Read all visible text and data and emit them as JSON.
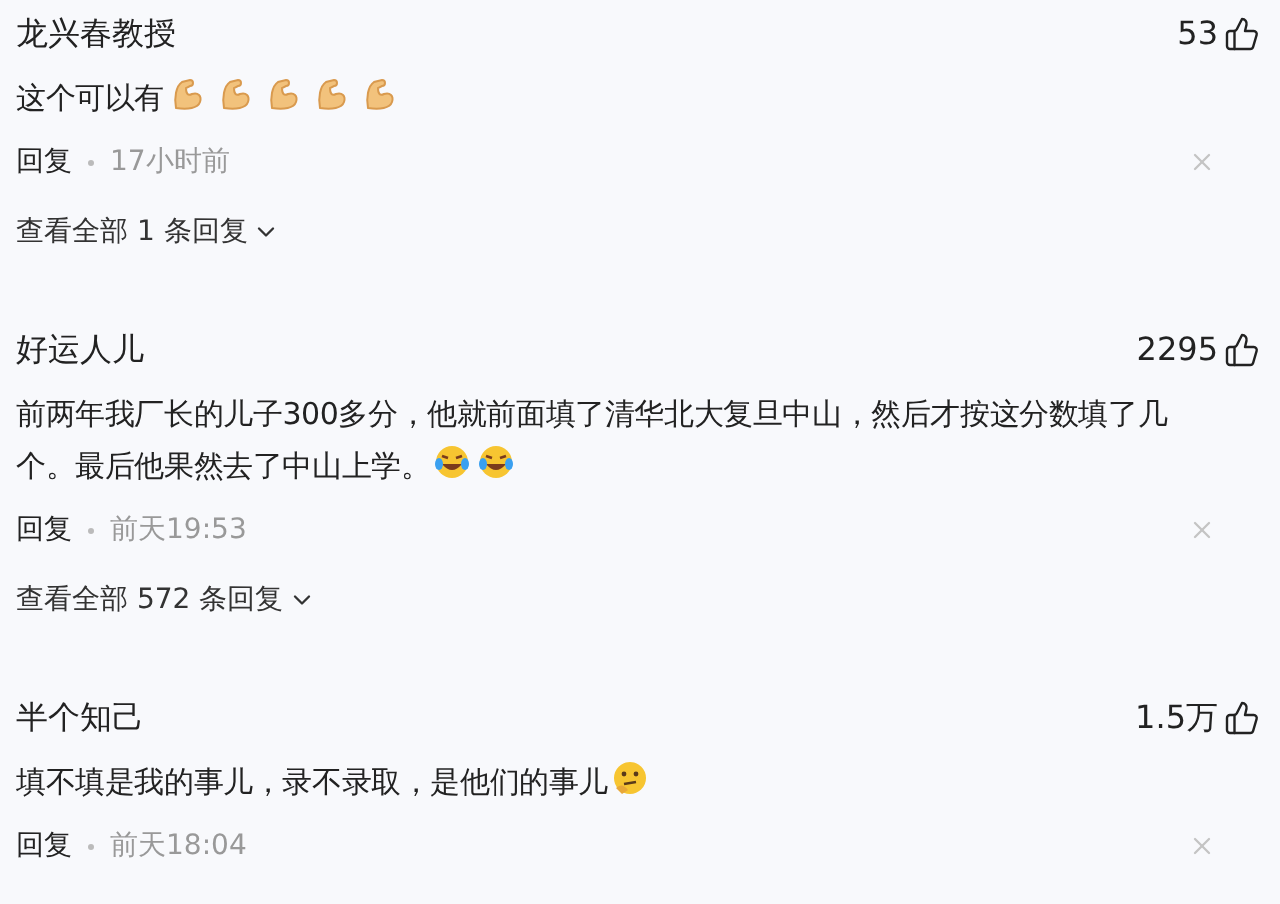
{
  "comments": [
    {
      "author": "龙兴春教授",
      "likes": "53",
      "text": "这个可以有",
      "emojis": [
        {
          "kind": "muscle"
        },
        {
          "kind": "muscle"
        },
        {
          "kind": "muscle"
        },
        {
          "kind": "muscle"
        },
        {
          "kind": "muscle"
        }
      ],
      "reply": "回复",
      "time": "17小时前",
      "view_replies": "查看全部 1 条回复"
    },
    {
      "author": "好运人儿",
      "likes": "2295",
      "text": "前两年我厂长的儿子300多分，他就前面填了清华北大复旦中山，然后才按这分数填了几个。最后他果然去了中山上学。",
      "emojis": [
        {
          "kind": "laugh-cry"
        },
        {
          "kind": "laugh-cry"
        }
      ],
      "reply": "回复",
      "time": "前天19:53",
      "view_replies": "查看全部 572 条回复"
    },
    {
      "author": "半个知己",
      "likes": "1.5万",
      "text": "填不填是我的事儿，录不录取，是他们的事儿",
      "emojis": [
        {
          "kind": "thinking"
        }
      ],
      "reply": "回复",
      "time": "前天18:04"
    }
  ]
}
